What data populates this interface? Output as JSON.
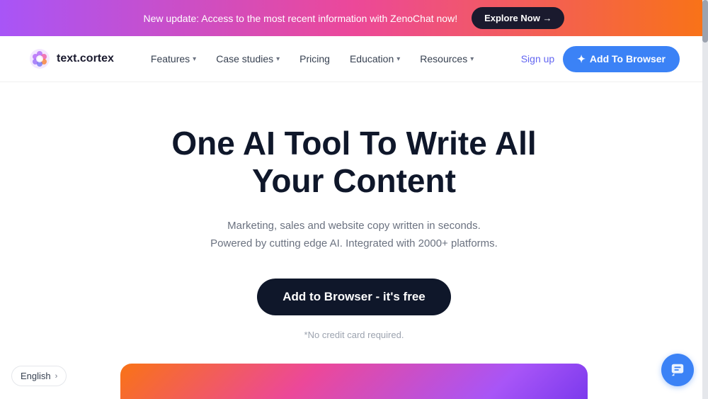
{
  "banner": {
    "text": "New update: Access to the most recent information with ZenoChat now!",
    "explore_btn": "Explore Now →"
  },
  "navbar": {
    "logo_text": "text.cortex",
    "links": [
      {
        "label": "Features",
        "has_dropdown": true
      },
      {
        "label": "Case studies",
        "has_dropdown": true
      },
      {
        "label": "Pricing",
        "has_dropdown": false
      },
      {
        "label": "Education",
        "has_dropdown": true
      },
      {
        "label": "Resources",
        "has_dropdown": true
      }
    ],
    "signup": "Sign up",
    "add_to_browser": "Add To Browser"
  },
  "hero": {
    "title": "One AI Tool To Write All Your Content",
    "subtitle_line1": "Marketing, sales and website copy written in seconds.",
    "subtitle_line2": "Powered by cutting edge AI. Integrated with 2000+ platforms.",
    "cta_btn": "Add to Browser - it's free",
    "no_credit": "*No credit card required."
  },
  "footer": {
    "language": "English",
    "language_chevron": "›"
  },
  "colors": {
    "accent_blue": "#3b82f6",
    "brand_dark": "#0f172a",
    "gradient_start": "#a855f7",
    "gradient_mid": "#ec4899",
    "gradient_end": "#f97316"
  }
}
